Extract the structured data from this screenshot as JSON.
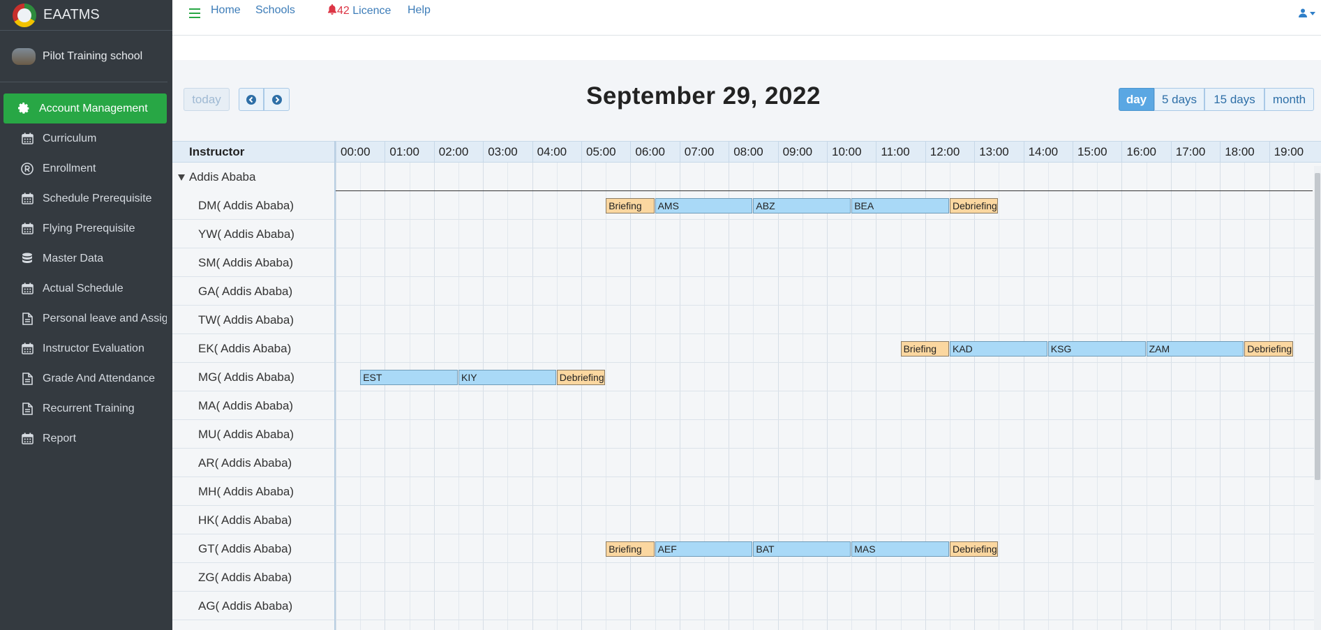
{
  "brand": {
    "name": "EAATMS"
  },
  "school": {
    "name": "Pilot Training school"
  },
  "sidebar": {
    "items": [
      {
        "label": "Account Management",
        "icon": "gear-icon",
        "active": true
      },
      {
        "label": "Curriculum",
        "icon": "calendar-icon"
      },
      {
        "label": "Enrollment",
        "icon": "registered-icon"
      },
      {
        "label": "Schedule Prerequisite",
        "icon": "calendar-icon"
      },
      {
        "label": "Flying Prerequisite",
        "icon": "calendar-icon"
      },
      {
        "label": "Master Data",
        "icon": "database-icon"
      },
      {
        "label": "Actual Schedule",
        "icon": "calendar-icon"
      },
      {
        "label": "Personal leave and Assignm",
        "icon": "document-icon"
      },
      {
        "label": "Instructor Evaluation",
        "icon": "calendar-icon"
      },
      {
        "label": "Grade And Attendance",
        "icon": "document-icon"
      },
      {
        "label": "Recurrent Training",
        "icon": "document-icon"
      },
      {
        "label": "Report",
        "icon": "calendar-icon"
      }
    ]
  },
  "topnav": {
    "home": "Home",
    "schools": "Schools",
    "licence_count": "42",
    "licence_label": " Licence",
    "help": "Help"
  },
  "calendar": {
    "title": "September 29, 2022",
    "today_label": "today",
    "prev_icon": "chevron-left-circle-icon",
    "next_icon": "chevron-right-circle-icon",
    "views": [
      "day",
      "5 days",
      "15 days",
      "month"
    ],
    "active_view": "day",
    "resource_header": "Instructor",
    "hours": [
      "00:00",
      "01:00",
      "02:00",
      "03:00",
      "04:00",
      "05:00",
      "06:00",
      "07:00",
      "08:00",
      "09:00",
      "10:00",
      "11:00",
      "12:00",
      "13:00",
      "14:00",
      "15:00",
      "16:00",
      "17:00",
      "18:00",
      "19:00"
    ],
    "group": "Addis Ababa",
    "resources": [
      "DM( Addis Ababa)",
      "YW( Addis Ababa)",
      "SM( Addis Ababa)",
      "GA( Addis Ababa)",
      "TW( Addis Ababa)",
      "EK( Addis Ababa)",
      "MG( Addis Ababa)",
      "MA( Addis Ababa)",
      "MU( Addis Ababa)",
      "AR( Addis Ababa)",
      "MH( Addis Ababa)",
      "HK( Addis Ababa)",
      "GT( Addis Ababa)",
      "ZG( Addis Ababa)",
      "AG( Addis Ababa)"
    ],
    "events": [
      {
        "row": 0,
        "start": 5.5,
        "end": 6.5,
        "title": "Briefing",
        "kind": "brief"
      },
      {
        "row": 0,
        "start": 6.5,
        "end": 8.5,
        "title": "AMS",
        "kind": "leg"
      },
      {
        "row": 0,
        "start": 8.5,
        "end": 10.5,
        "title": "ABZ",
        "kind": "leg"
      },
      {
        "row": 0,
        "start": 10.5,
        "end": 12.5,
        "title": "BEA",
        "kind": "leg"
      },
      {
        "row": 0,
        "start": 12.5,
        "end": 13.5,
        "title": "Debriefing",
        "kind": "brief"
      },
      {
        "row": 5,
        "start": 11.5,
        "end": 12.5,
        "title": "Briefing",
        "kind": "brief"
      },
      {
        "row": 5,
        "start": 12.5,
        "end": 14.5,
        "title": "KAD",
        "kind": "leg"
      },
      {
        "row": 5,
        "start": 14.5,
        "end": 16.5,
        "title": "KSG",
        "kind": "leg"
      },
      {
        "row": 5,
        "start": 16.5,
        "end": 18.5,
        "title": "ZAM",
        "kind": "leg"
      },
      {
        "row": 5,
        "start": 18.5,
        "end": 19.5,
        "title": "Debriefing",
        "kind": "brief"
      },
      {
        "row": 6,
        "start": 0.5,
        "end": 2.5,
        "title": "EST",
        "kind": "leg"
      },
      {
        "row": 6,
        "start": 2.5,
        "end": 4.5,
        "title": "KIY",
        "kind": "leg"
      },
      {
        "row": 6,
        "start": 4.5,
        "end": 5.5,
        "title": "Debriefing",
        "kind": "brief"
      },
      {
        "row": 12,
        "start": 5.5,
        "end": 6.5,
        "title": "Briefing",
        "kind": "brief"
      },
      {
        "row": 12,
        "start": 6.5,
        "end": 8.5,
        "title": "AEF",
        "kind": "leg"
      },
      {
        "row": 12,
        "start": 8.5,
        "end": 10.5,
        "title": "BAT",
        "kind": "leg"
      },
      {
        "row": 12,
        "start": 10.5,
        "end": 12.5,
        "title": "MAS",
        "kind": "leg"
      },
      {
        "row": 12,
        "start": 12.5,
        "end": 13.5,
        "title": "Debriefing",
        "kind": "brief"
      }
    ]
  }
}
